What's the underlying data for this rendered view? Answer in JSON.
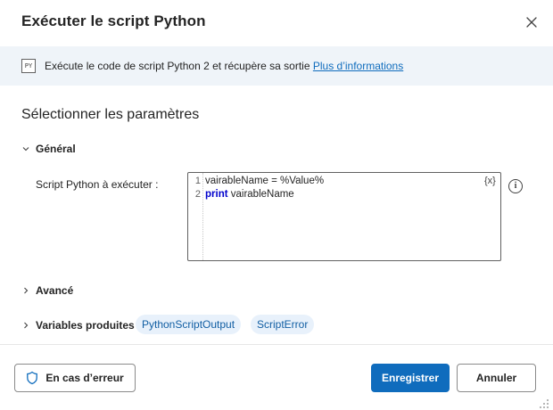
{
  "dialog": {
    "title": "Exécuter le script Python",
    "close_icon": "close-icon"
  },
  "info": {
    "icon_label": "PY",
    "text": "Exécute le code de script Python 2 et récupère sa sortie ",
    "link": "Plus d’informations"
  },
  "section": {
    "title": "Sélectionner les paramètres"
  },
  "general": {
    "label": "Général",
    "param_label": "Script Python à exécuter :",
    "code_lines": [
      {
        "number": "1",
        "text": "vairableName = %Value%"
      },
      {
        "number": "2",
        "keyword": "print",
        "text": " vairableName"
      }
    ],
    "variable_button": "{x}",
    "info_glyph": "i"
  },
  "advanced": {
    "label": "Avancé"
  },
  "produced_variables": {
    "label": "Variables produites",
    "chips": [
      "PythonScriptOutput",
      "ScriptError"
    ]
  },
  "footer": {
    "on_error": "En cas d’erreur",
    "save": "Enregistrer",
    "cancel": "Annuler"
  },
  "colors": {
    "accent": "#0f6cbd",
    "info_background": "#eff4f9",
    "chip_background": "#e8f1fb",
    "chip_text": "#115ea3",
    "keyword": "#0000cc"
  }
}
